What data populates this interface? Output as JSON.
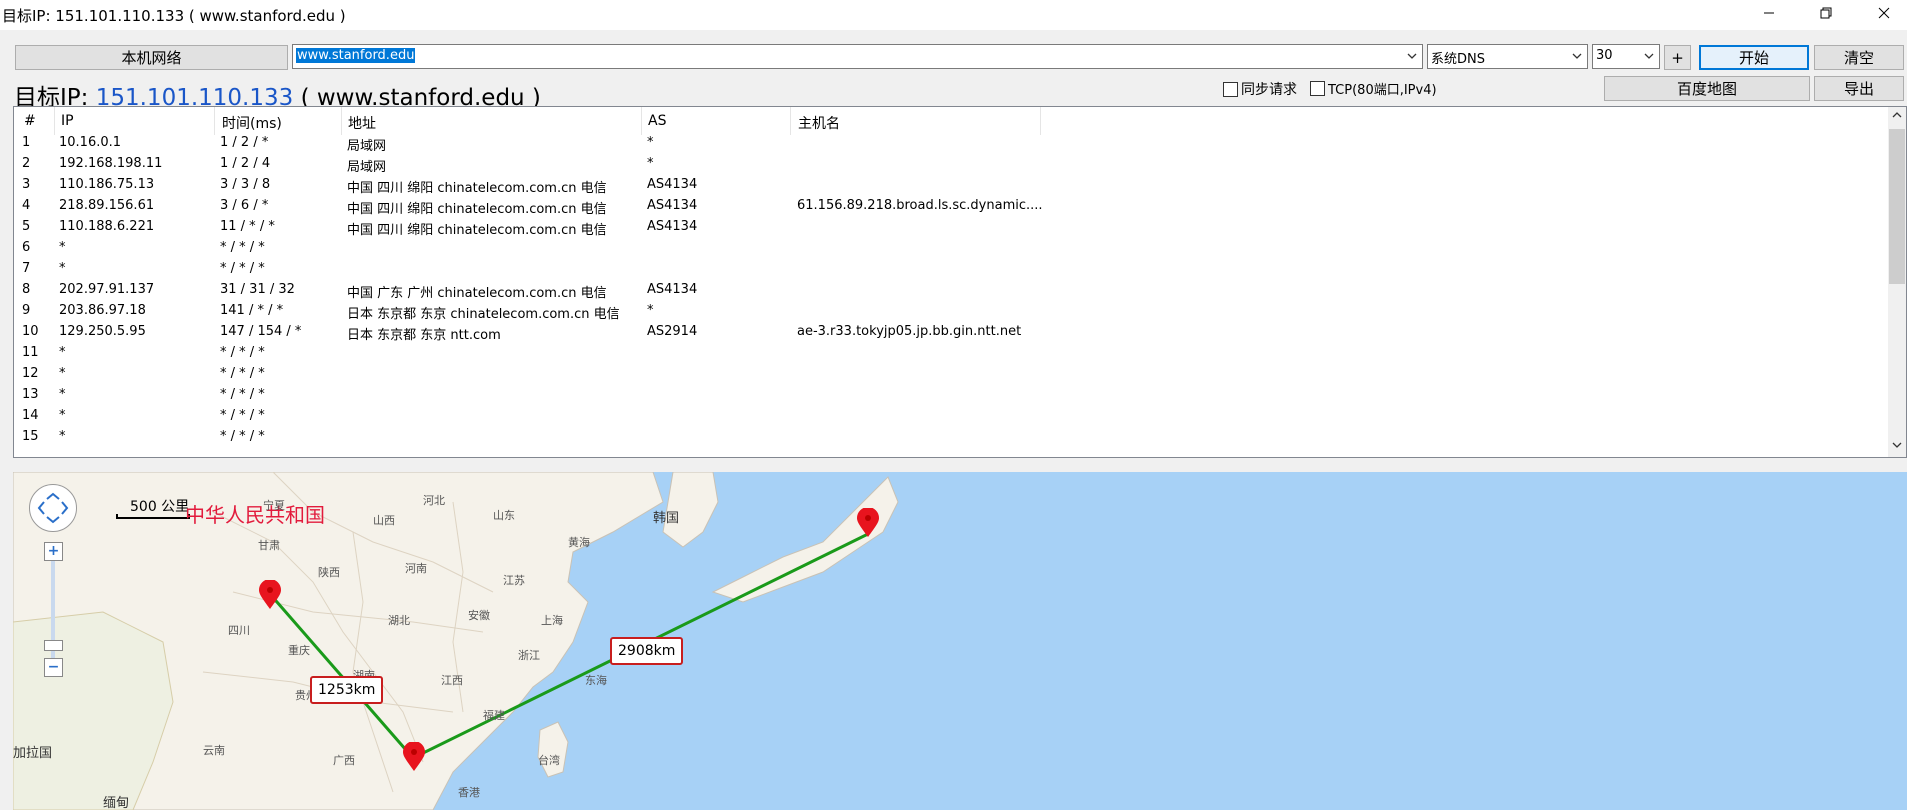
{
  "window": {
    "title": "目标IP: 151.101.110.133 ( www.stanford.edu )",
    "minimize_icon": "minimize-icon",
    "restore_icon": "restore-icon",
    "close_icon": "close-icon"
  },
  "toolbar": {
    "network_button": "本机网络",
    "url_value": "www.stanford.edu",
    "dns_value": "系统DNS",
    "hops_value": "30",
    "plus_button": "+",
    "start_button": "开始",
    "clear_button": "清空",
    "baidu_map_button": "百度地图",
    "export_button": "导出"
  },
  "target": {
    "prefix": "目标IP: ",
    "ip": "151.101.110.133",
    "suffix": " ( www.stanford.edu )"
  },
  "options": {
    "sync_label": "同步请求",
    "tcp_label": "TCP(80端口,IPv4)"
  },
  "table": {
    "headers": [
      "#",
      "IP",
      "时间(ms)",
      "地址",
      "AS",
      "主机名"
    ],
    "rows": [
      [
        "1",
        "10.16.0.1",
        "1 / 2 / *",
        "局域网",
        "*",
        ""
      ],
      [
        "2",
        "192.168.198.11",
        "1 / 2 / 4",
        "局域网",
        "*",
        ""
      ],
      [
        "3",
        "110.186.75.13",
        "3 / 3 / 8",
        "中国 四川 绵阳 chinatelecom.com.cn 电信",
        "AS4134",
        ""
      ],
      [
        "4",
        "218.89.156.61",
        "3 / 6 / *",
        "中国 四川 绵阳 chinatelecom.com.cn 电信",
        "AS4134",
        "61.156.89.218.broad.ls.sc.dynamic...."
      ],
      [
        "5",
        "110.188.6.221",
        "11 / * / *",
        "中国 四川 绵阳 chinatelecom.com.cn 电信",
        "AS4134",
        ""
      ],
      [
        "6",
        "*",
        "* / * / *",
        "",
        "",
        ""
      ],
      [
        "7",
        "*",
        "* / * / *",
        "",
        "",
        ""
      ],
      [
        "8",
        "202.97.91.137",
        "31 / 31 / 32",
        "中国 广东 广州 chinatelecom.com.cn 电信",
        "AS4134",
        ""
      ],
      [
        "9",
        "203.86.97.18",
        "141 / * / *",
        "日本 东京都 东京 chinatelecom.com.cn 电信",
        "*",
        ""
      ],
      [
        "10",
        "129.250.5.95",
        "147 / 154 / *",
        "日本 东京都 东京 ntt.com",
        "AS2914",
        "ae-3.r33.tokyjp05.jp.bb.gin.ntt.net"
      ],
      [
        "11",
        "*",
        "* / * / *",
        "",
        "",
        ""
      ],
      [
        "12",
        "*",
        "* / * / *",
        "",
        "",
        ""
      ],
      [
        "13",
        "*",
        "* / * / *",
        "",
        "",
        ""
      ],
      [
        "14",
        "*",
        "* / * / *",
        "",
        "",
        ""
      ],
      [
        "15",
        "*",
        "* / * / *",
        "",
        "",
        ""
      ]
    ]
  },
  "map": {
    "scale": "500 公里",
    "country": "中华人民共和国",
    "distances": [
      "1253km",
      "2908km"
    ],
    "labels": [
      "河北",
      "山西",
      "山东",
      "陕西",
      "河南",
      "江苏",
      "安徽",
      "湖北",
      "上海",
      "浙江",
      "四川",
      "江西",
      "湖南",
      "福建",
      "贵州",
      "云南",
      "广西",
      "台湾",
      "香港",
      "韩国",
      "黄海",
      "东海",
      "缅甸",
      "加拉国",
      "甘肃",
      "重庆",
      "宁夏"
    ],
    "route_color": "#1a9a1a",
    "pin_color": "#e8141e"
  }
}
